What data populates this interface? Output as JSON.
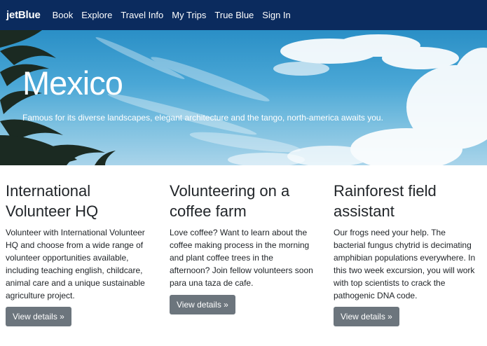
{
  "navbar": {
    "brand": "jetBlue",
    "items": [
      {
        "label": "Book"
      },
      {
        "label": "Explore"
      },
      {
        "label": "Travel Info"
      },
      {
        "label": "My Trips"
      },
      {
        "label": "True Blue"
      },
      {
        "label": "Sign In"
      }
    ],
    "bg_color": "#0b2b5e"
  },
  "hero": {
    "title": "Mexico",
    "subtitle": "Famous for its diverse landscapes, elegant architecture and the tango, north-america awaits you."
  },
  "cards": [
    {
      "title": "International Volunteer HQ",
      "body": "Volunteer with International Volunteer HQ and choose from a wide range of volunteer opportunities available, including teaching english, childcare, animal care and a unique sustainable agriculture project.",
      "button": "View details »"
    },
    {
      "title": "Volunteering on a coffee farm",
      "body": "Love coffee? Want to learn about the coffee making process in the morning and plant coffee trees in the afternoon? Join fellow volunteers soon para una taza de cafe.",
      "button": "View details »"
    },
    {
      "title": "Rainforest field assistant",
      "body": "Our frogs need your help. The bacterial fungus chytrid is decimating amphibian populations everywhere. In this two week excursion, you will work with top scientists to crack the pathogenic DNA code.",
      "button": "View details »"
    }
  ],
  "colors": {
    "button_bg": "#6c757d"
  }
}
